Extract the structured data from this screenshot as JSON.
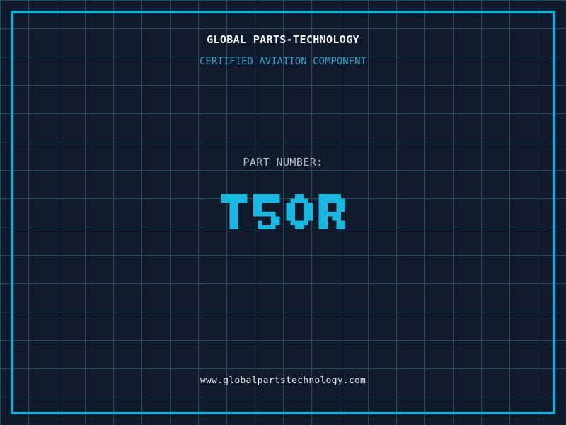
{
  "colors": {
    "background": "#101a2b",
    "grid_line": "#1d4e63",
    "frame_border": "#0cb2d9",
    "title_text": "#f2f3f5",
    "subtitle_text": "#2fa3cd",
    "label_text": "#b9bdc7",
    "part_number_text": "#17b9e0",
    "footer_text": "#e9ebee"
  },
  "header": {
    "title": "GLOBAL PARTS-TECHNOLOGY",
    "subtitle": "CERTIFIED AVIATION COMPONENT"
  },
  "part": {
    "label": "PART NUMBER:",
    "number": "T50R"
  },
  "footer": {
    "url": "www.globalpartstechnology.com"
  }
}
